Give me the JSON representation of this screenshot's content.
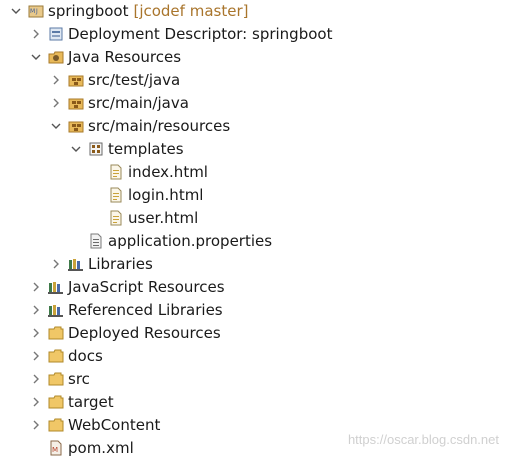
{
  "tree": {
    "root": {
      "label": "springboot",
      "scm": "[jcodef master]",
      "icon": "java-project-icon",
      "expanded": true
    },
    "items": [
      {
        "label": "Deployment Descriptor: springboot",
        "icon": "deployment-descriptor-icon",
        "expanded": false
      },
      {
        "label": "Java Resources",
        "icon": "java-resources-icon",
        "expanded": true
      },
      {
        "label": "src/test/java",
        "icon": "package-folder-icon",
        "expanded": false
      },
      {
        "label": "src/main/java",
        "icon": "package-folder-icon",
        "expanded": false
      },
      {
        "label": "src/main/resources",
        "icon": "package-folder-icon",
        "expanded": true
      },
      {
        "label": "templates",
        "icon": "package-icon",
        "expanded": true
      },
      {
        "label": "index.html",
        "icon": "html-file-icon"
      },
      {
        "label": "login.html",
        "icon": "html-file-icon"
      },
      {
        "label": "user.html",
        "icon": "html-file-icon"
      },
      {
        "label": "application.properties",
        "icon": "properties-file-icon"
      },
      {
        "label": "Libraries",
        "icon": "libraries-icon",
        "expanded": false
      },
      {
        "label": "JavaScript Resources",
        "icon": "javascript-resources-icon",
        "expanded": false
      },
      {
        "label": "Referenced Libraries",
        "icon": "libraries-icon",
        "expanded": false
      },
      {
        "label": "Deployed Resources",
        "icon": "folder-icon",
        "expanded": false
      },
      {
        "label": "docs",
        "icon": "folder-icon",
        "expanded": false
      },
      {
        "label": "src",
        "icon": "folder-icon",
        "expanded": false
      },
      {
        "label": "target",
        "icon": "folder-icon",
        "expanded": false
      },
      {
        "label": "WebContent",
        "icon": "folder-icon",
        "expanded": false
      },
      {
        "label": "pom.xml",
        "icon": "xml-file-icon"
      }
    ]
  },
  "watermark": "https://oscar.blog.csdn.net",
  "colors": {
    "scm": "#a9752c",
    "folder": "#e8b95a",
    "package": "#c98a3a",
    "text": "#1a1a1a"
  }
}
